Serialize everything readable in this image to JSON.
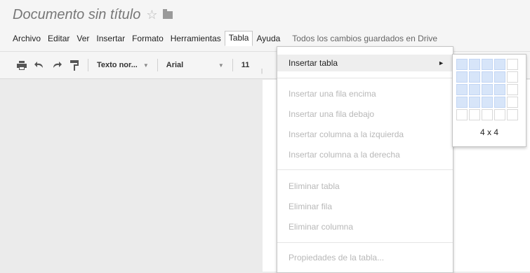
{
  "document": {
    "title": "Documento sin título"
  },
  "menubar": {
    "items": [
      "Archivo",
      "Editar",
      "Ver",
      "Insertar",
      "Formato",
      "Herramientas",
      "Tabla",
      "Ayuda"
    ],
    "active": "Tabla",
    "save_status": "Todos los cambios guardados en Drive"
  },
  "toolbar": {
    "style_select": "Texto nor...",
    "font_select": "Arial",
    "size_select": "11"
  },
  "table_menu": {
    "insert_table": "Insertar tabla",
    "insert_row_above": "Insertar una fila encima",
    "insert_row_below": "Insertar una fila debajo",
    "insert_col_left": "Insertar columna a la izquierda",
    "insert_col_right": "Insertar columna a la derecha",
    "delete_table": "Eliminar tabla",
    "delete_row": "Eliminar fila",
    "delete_col": "Eliminar columna",
    "table_properties": "Propiedades de la tabla..."
  },
  "table_grid": {
    "label": "4 x 4",
    "rows": 5,
    "cols": 5,
    "selected_rows": 4,
    "selected_cols": 4
  },
  "colors": {
    "grid_selected": "#d7e5f9",
    "disabled_text": "#b8b8b8"
  }
}
